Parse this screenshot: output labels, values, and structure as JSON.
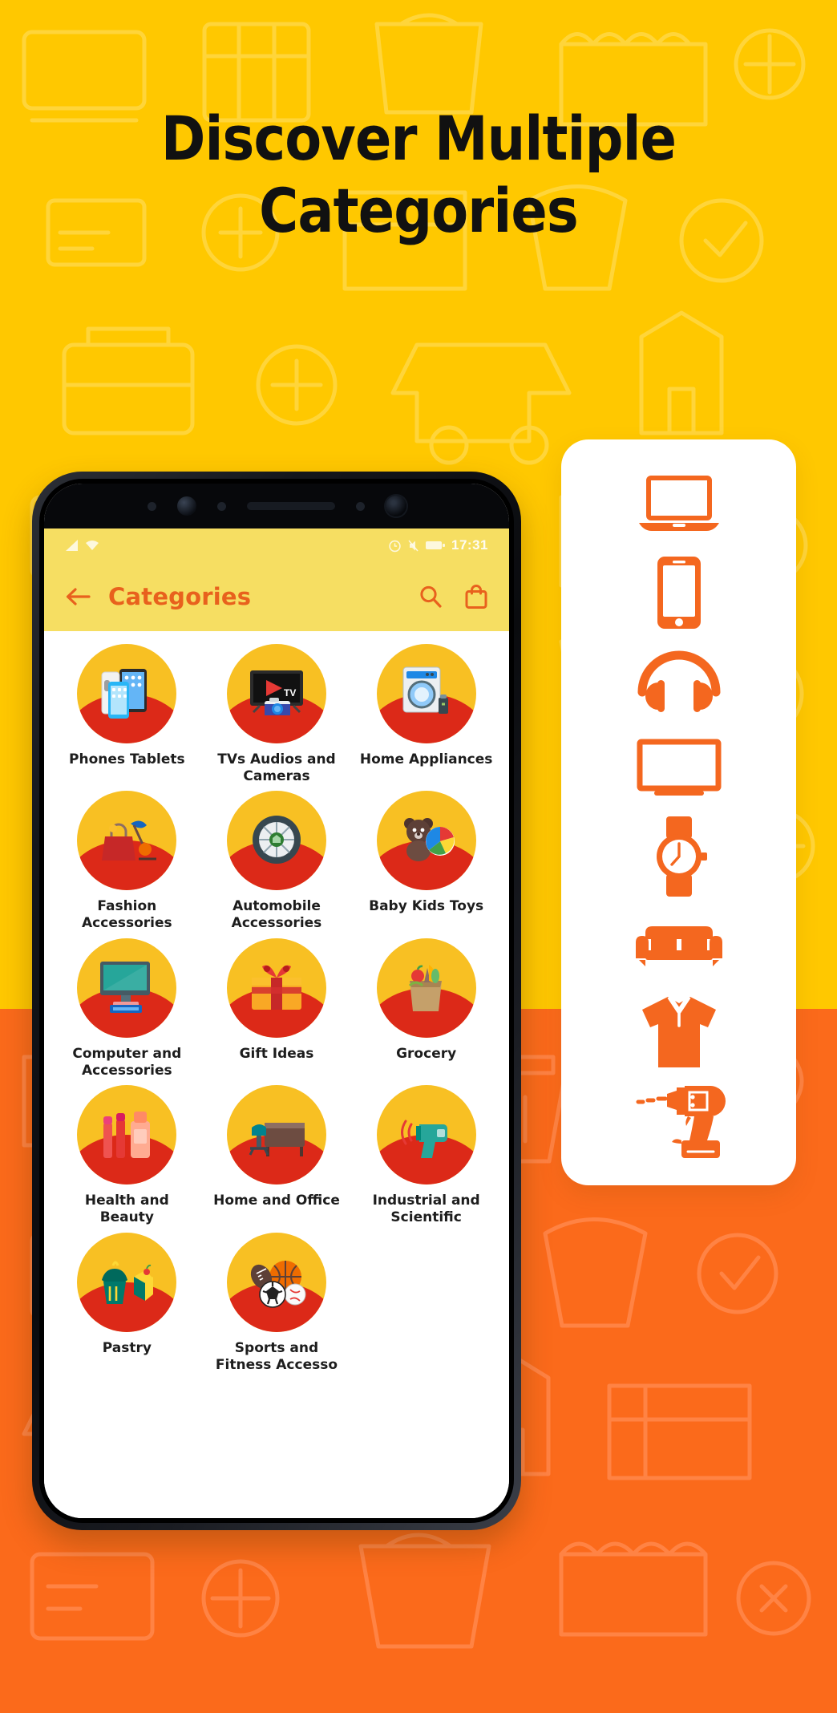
{
  "headline": {
    "line1": "Discover Multiple",
    "line2": "Categories"
  },
  "colors": {
    "bg_yellow": "#FFC800",
    "bg_orange": "#FB6A1B",
    "accent_orange": "#F4671F",
    "appbar_yellow": "#F6DE62",
    "circle_top": "#F8C023",
    "circle_bottom": "#DC2918",
    "title_text": "#111111"
  },
  "phone": {
    "status_bar": {
      "clock": "17:31",
      "left_icons": [
        "signal-icon",
        "wifi-icon"
      ],
      "right_icons": [
        "alarm-icon",
        "silent-icon",
        "battery-icon"
      ]
    },
    "app_bar": {
      "back_label": "back-arrow-icon",
      "title": "Categories",
      "search_label": "search-icon",
      "cart_label": "shopping-bag-icon"
    },
    "categories": [
      {
        "label": "Phones Tablets",
        "icon": "phones-tablets-icon"
      },
      {
        "label": "TVs Audios and Cameras",
        "icon": "tv-camera-icon"
      },
      {
        "label": "Home Appliances",
        "icon": "washing-machine-icon"
      },
      {
        "label": "Fashion Accessories",
        "icon": "fashion-bag-icon"
      },
      {
        "label": "Automobile Accessories",
        "icon": "tyre-icon"
      },
      {
        "label": "Baby Kids Toys",
        "icon": "teddy-bear-icon"
      },
      {
        "label": "Computer and Accessories",
        "icon": "desktop-computer-icon"
      },
      {
        "label": "Gift Ideas",
        "icon": "gift-box-icon"
      },
      {
        "label": "Grocery",
        "icon": "grocery-bag-icon"
      },
      {
        "label": "Health and Beauty",
        "icon": "cosmetics-icon"
      },
      {
        "label": "Home and Office",
        "icon": "office-desk-icon"
      },
      {
        "label": "Industrial and Scientific",
        "icon": "thermometer-gun-icon"
      },
      {
        "label": "Pastry",
        "icon": "cupcake-cake-icon"
      },
      {
        "label": "Sports and Fitness Accesso",
        "icon": "sports-balls-icon"
      }
    ]
  },
  "icon_card": {
    "icons": [
      "laptop-icon",
      "smartphone-icon",
      "headphones-icon",
      "television-icon",
      "wristwatch-icon",
      "sofa-icon",
      "tshirt-icon",
      "power-drill-icon"
    ]
  }
}
